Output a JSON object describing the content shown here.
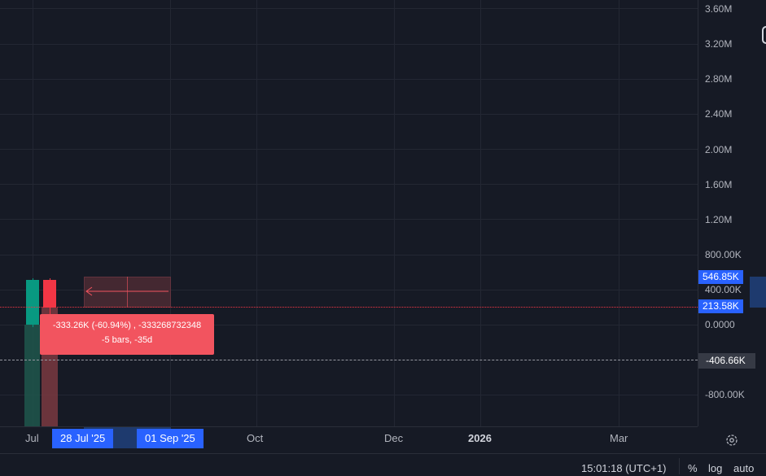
{
  "price_axis": {
    "labels": [
      "3.60M",
      "3.20M",
      "2.80M",
      "2.40M",
      "2.00M",
      "1.60M",
      "1.20M",
      "800.00K",
      "400.00K",
      "0.0000",
      "-800.00K"
    ],
    "badge_high": "546.85K",
    "badge_current": "213.58K",
    "badge_crosshair": "-406.66K",
    "colors": {
      "badge_blue": "#2962ff",
      "badge_dark": "#363a45"
    }
  },
  "time_axis": {
    "labels": [
      "Jul",
      "Oct",
      "Dec",
      "2026",
      "Mar"
    ],
    "range_start": "28 Jul '25",
    "range_end": "01 Sep '25"
  },
  "measure_tooltip": {
    "line1": "-333.26K (-60.94%) , -333268732348",
    "line2": "-5 bars, -35d"
  },
  "status_bar": {
    "time": "15:01:18 (UTC+1)",
    "percent": "%",
    "log": "log",
    "auto": "auto"
  },
  "icons": {
    "settings": "gear-icon",
    "measure_arrow": "arrow-left-icon"
  },
  "colors": {
    "background": "#161a25",
    "up": "#089981",
    "down": "#f23645",
    "tooltip": "#f2545f"
  }
}
